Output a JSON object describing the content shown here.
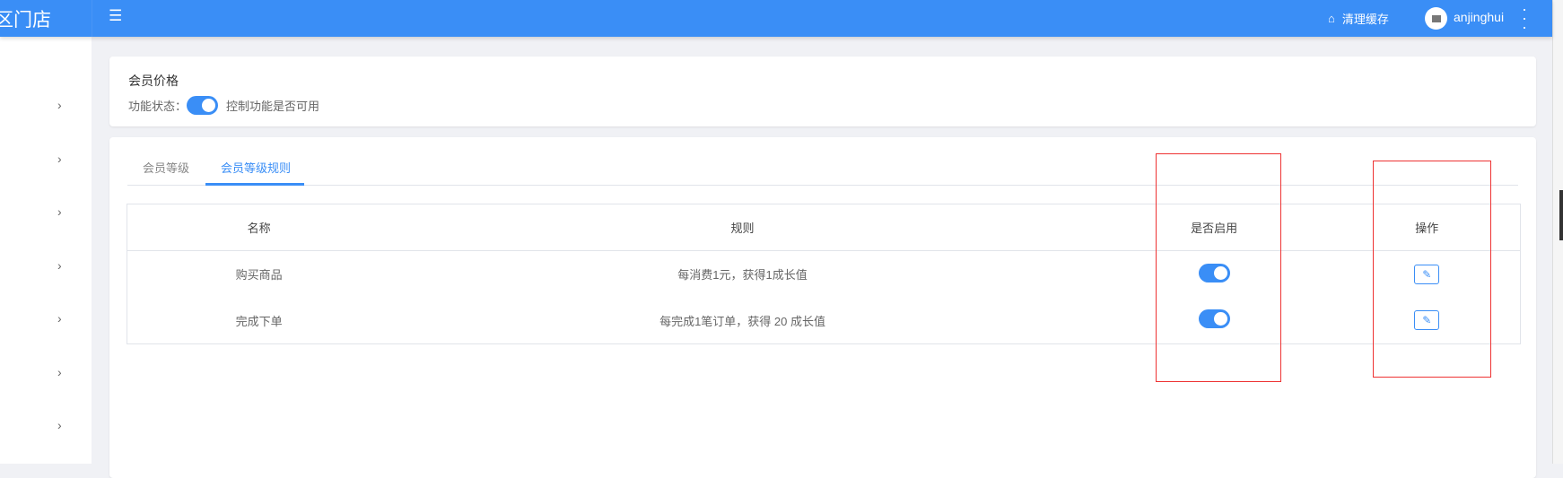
{
  "header": {
    "logo": "区门店",
    "clear_cache": "清理缓存",
    "username": "anjinghui"
  },
  "card1": {
    "title": "会员价格",
    "status_label": "功能状态：",
    "status_desc": "控制功能是否可用",
    "enabled": true
  },
  "tabs": [
    {
      "label": "会员等级"
    },
    {
      "label": "会员等级规则",
      "active": true
    }
  ],
  "table": {
    "headers": [
      "名称",
      "规则",
      "是否启用",
      "操作"
    ],
    "rows": [
      {
        "name": "购买商品",
        "rule": "每消费1元，获得1成长值",
        "enabled": true
      },
      {
        "name": "完成下单",
        "rule": "每完成1笔订单，获得 20 成长值",
        "enabled": true
      }
    ]
  },
  "colors": {
    "primary": "#3a8ef6",
    "annotation": "#e33333"
  }
}
